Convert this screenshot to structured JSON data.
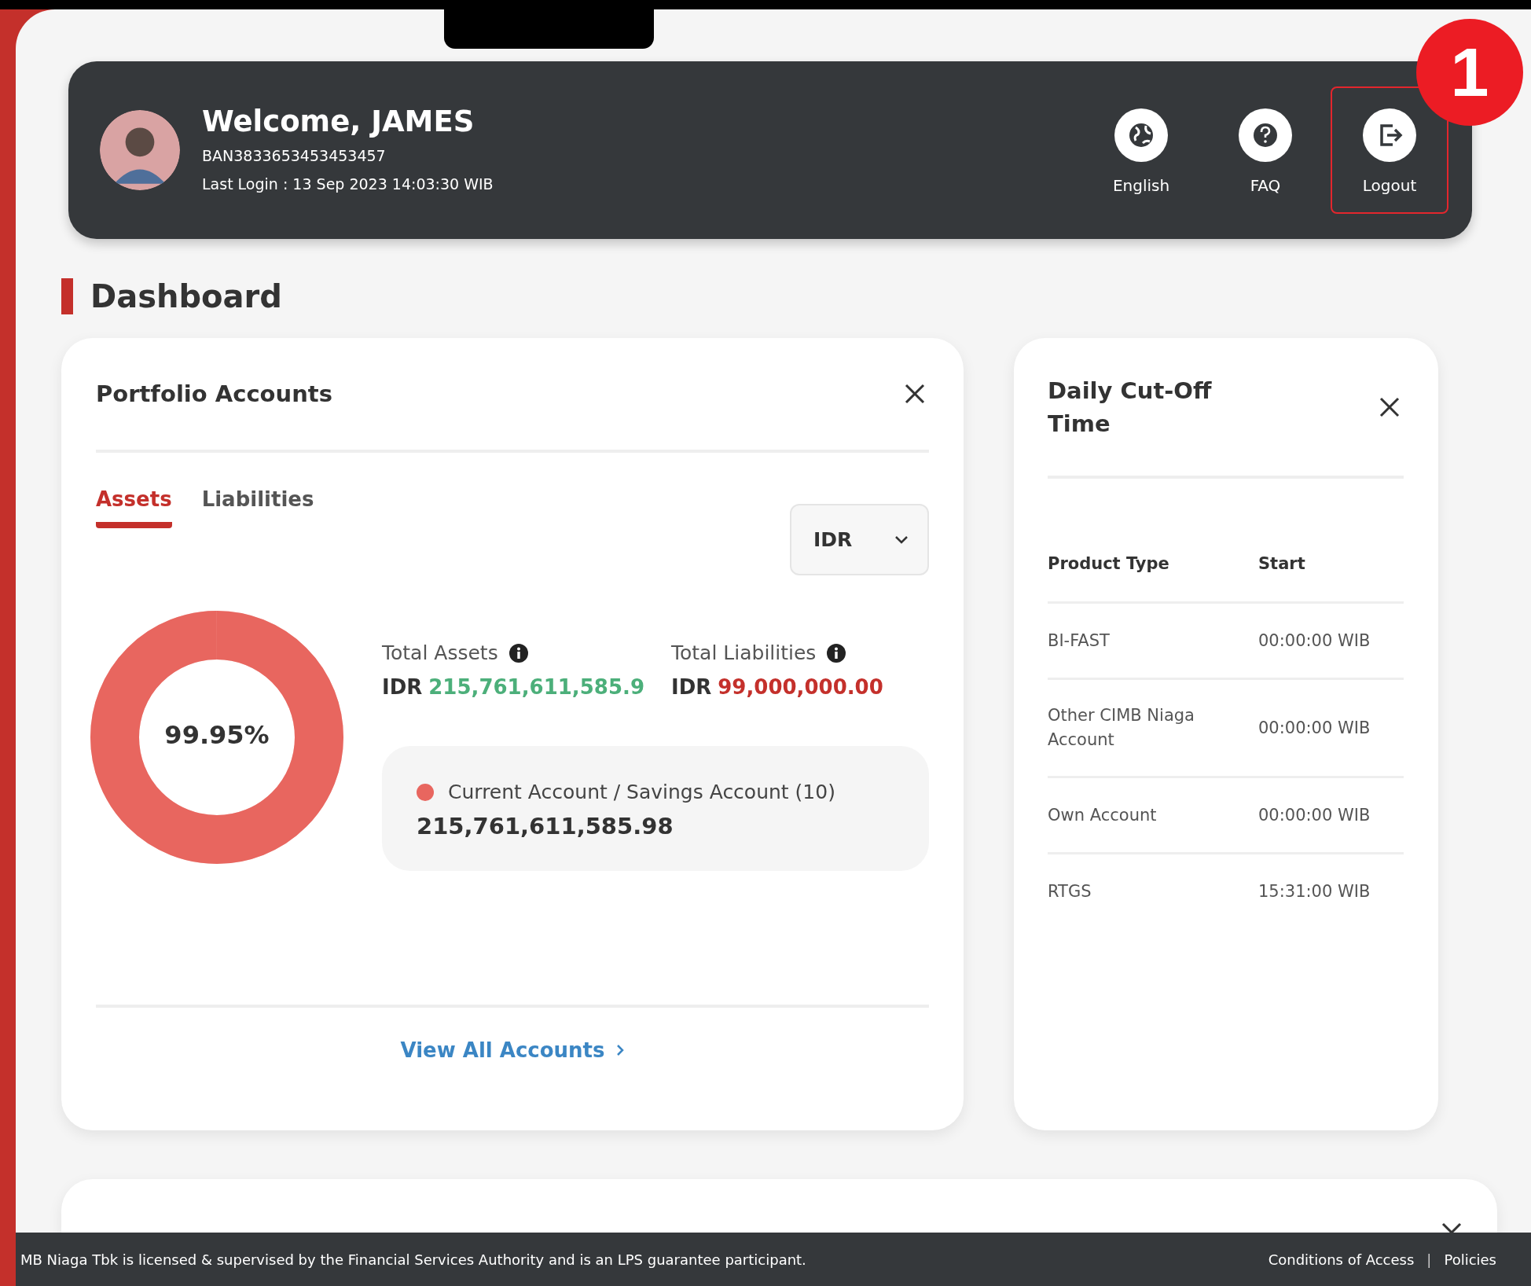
{
  "header": {
    "welcome": "Welcome, JAMES",
    "account_id": "BAN3833653453453457",
    "last_login": "Last Login : 13 Sep 2023 14:03:30 WIB",
    "actions": [
      {
        "kind": "language",
        "label": "English",
        "highlighted": false
      },
      {
        "kind": "faq",
        "label": "FAQ",
        "highlighted": false
      },
      {
        "kind": "logout",
        "label": "Logout",
        "highlighted": true
      }
    ]
  },
  "annotation": {
    "number": "1"
  },
  "page_title": "Dashboard",
  "portfolio": {
    "title": "Portfolio Accounts",
    "tabs": [
      {
        "label": "Assets",
        "selected": true
      },
      {
        "label": "Liabilities",
        "selected": false
      }
    ],
    "currency": "IDR",
    "donut": {
      "level": 0.9995,
      "reading": "99.95%"
    },
    "totals": [
      {
        "label": "Total Assets",
        "currency": "IDR",
        "value": "215,761,611,585.9",
        "kind": "asset"
      },
      {
        "label": "Total Liabilities",
        "currency": "IDR",
        "value": "99,000,000.00",
        "kind": "liability"
      }
    ],
    "accounts": [
      {
        "name": "Current Account / Savings Account (10)",
        "amount": "215,761,611,585.98",
        "color": "#e8665f"
      }
    ],
    "link": "View All Accounts"
  },
  "cutoff": {
    "title": "Daily Cut-Off Time",
    "columns": [
      "Product Type",
      "Start"
    ],
    "rows": [
      [
        "BI-FAST",
        "00:00:00 WIB"
      ],
      [
        "Other CIMB Niaga Account",
        "00:00:00 WIB"
      ],
      [
        "Own Account",
        "00:00:00 WIB"
      ],
      [
        "RTGS",
        "15:31:00 WIB"
      ]
    ]
  },
  "footer": {
    "notice": "MB Niaga Tbk is licensed & supervised by the Financial Services Authority and is an LPS guarantee participant.",
    "links": [
      "Conditions of Access",
      "Policies"
    ],
    "separator": "|"
  }
}
